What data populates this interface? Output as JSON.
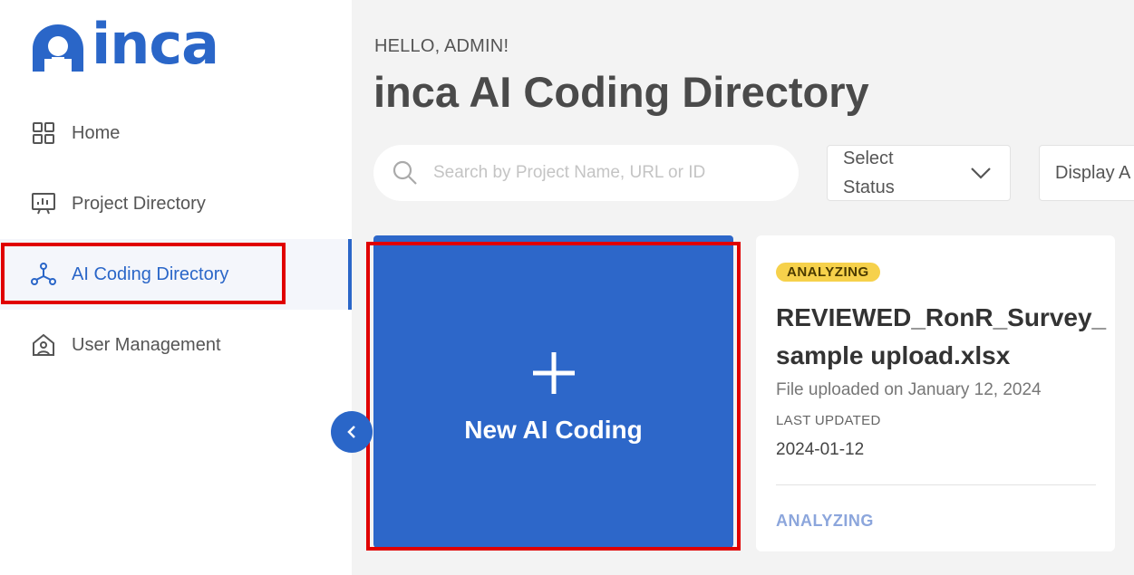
{
  "brand": {
    "name": "inca",
    "color": "#2a66c8"
  },
  "sidebar": {
    "items": [
      {
        "label": "Home",
        "icon": "grid-icon",
        "active": false
      },
      {
        "label": "Project Directory",
        "icon": "chart-board-icon",
        "active": false
      },
      {
        "label": "AI Coding Directory",
        "icon": "network-nodes-icon",
        "active": true
      },
      {
        "label": "User Management",
        "icon": "home-user-icon",
        "active": false
      }
    ],
    "collapse_icon": "chevron-left-icon"
  },
  "header": {
    "greeting": "HELLO, ADMIN!",
    "title": "inca AI Coding Directory"
  },
  "filters": {
    "search_placeholder": "Search by Project Name, URL or ID",
    "select_status": "Select Status",
    "display": "Display A"
  },
  "new_card": {
    "label": "New AI Coding",
    "color": "#2d67c9"
  },
  "project": {
    "badge": "ANALYZING",
    "name": "REVIEWED_RonR_Survey_ sample upload.xlsx",
    "uploaded": "File uploaded on January 12, 2024",
    "last_updated_label": "LAST UPDATED",
    "last_updated": "2024-01-12",
    "status": "ANALYZING"
  },
  "highlight_color": "#e00000"
}
